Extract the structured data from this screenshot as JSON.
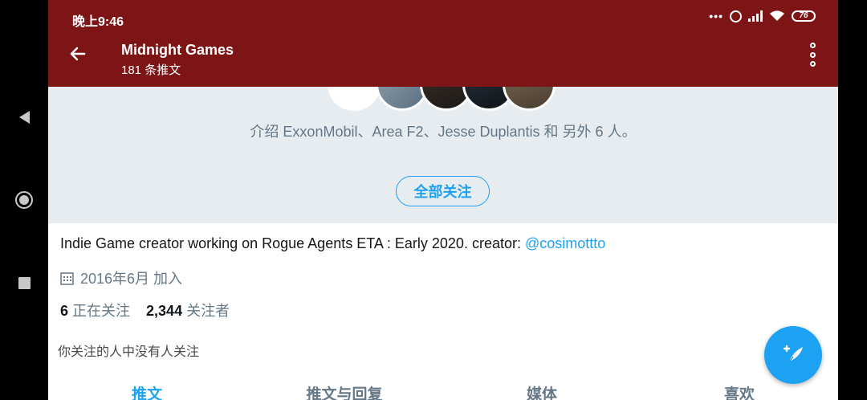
{
  "status_bar": {
    "time": "晚上9:46",
    "battery": "76"
  },
  "header": {
    "title": "Midnight Games",
    "subtitle": "181 条推文"
  },
  "followed_by": {
    "text": "介绍 ExxonMobil、Area F2、Jesse Duplantis 和 另外 6 人。",
    "button": "全部关注"
  },
  "profile": {
    "bio_text": "Indie Game creator working on Rogue Agents ETA : Early 2020. creator: ",
    "bio_mention": "@cosimottto",
    "joined": "2016年6月 加入",
    "following_count": "6",
    "following_label": "正在关注",
    "followers_count": "2,344",
    "followers_label": "关注者",
    "no_mutual": "你关注的人中没有人关注"
  },
  "tabs": [
    {
      "label": "推文",
      "active": true
    },
    {
      "label": "推文与回复",
      "active": false
    },
    {
      "label": "媒体",
      "active": false
    },
    {
      "label": "喜欢",
      "active": false
    }
  ],
  "colors": {
    "header": "#7d1416",
    "accent": "#1da1f2",
    "panel": "#e6ecf0"
  }
}
